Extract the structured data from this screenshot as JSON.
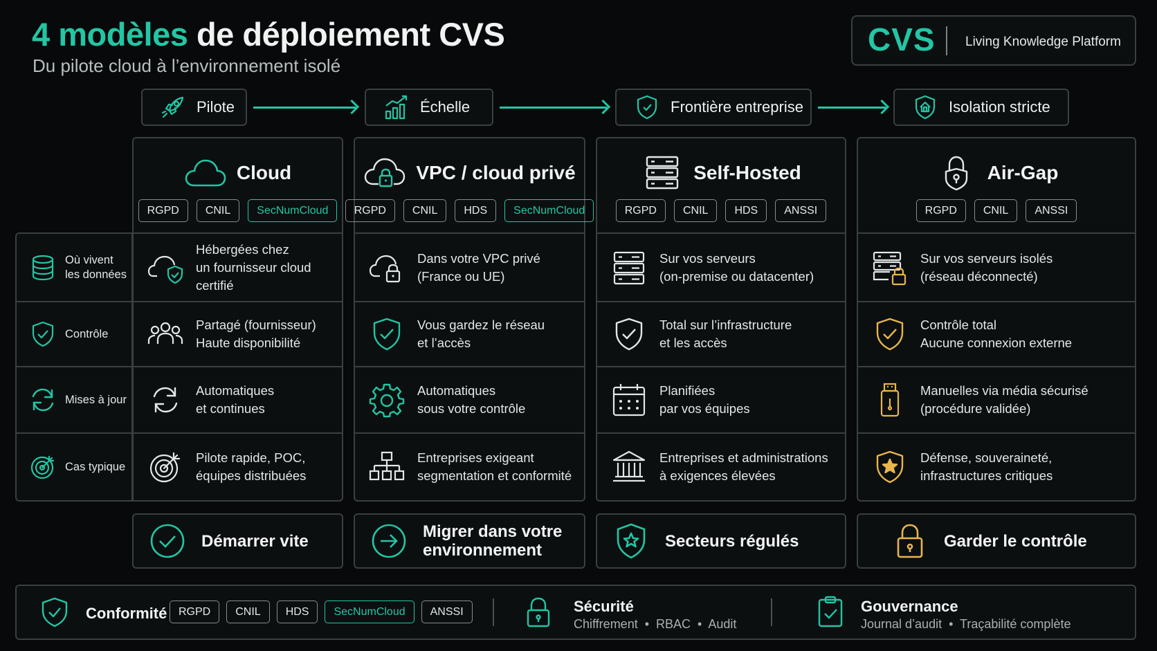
{
  "header": {
    "title_accent": "4 modèles",
    "title_rest": " de déploiement CVS",
    "subtitle": "Du pilote cloud à l’environnement isolé"
  },
  "logo": {
    "mark": "CVS",
    "tagline": "Living Knowledge Platform"
  },
  "stages": [
    {
      "label": "Pilote",
      "icon": "rocket-icon"
    },
    {
      "label": "Échelle",
      "icon": "growth-chart-icon"
    },
    {
      "label": "Frontière entreprise",
      "icon": "shield-icon"
    },
    {
      "label": "Isolation stricte",
      "icon": "shield-home-icon"
    }
  ],
  "columns": [
    {
      "title": "Cloud",
      "icon": "cloud-icon",
      "badges": [
        "RGPD",
        "CNIL",
        "SecNumCloud"
      ]
    },
    {
      "title": "VPC / cloud privé",
      "icon": "cloud-lock-icon",
      "badges": [
        "RGPD",
        "CNIL",
        "HDS",
        "SecNumCloud"
      ]
    },
    {
      "title": "Self-Hosted",
      "icon": "server-icon",
      "badges": [
        "RGPD",
        "CNIL",
        "HDS",
        "ANSSI"
      ]
    },
    {
      "title": "Air-Gap",
      "icon": "padlock-shield-icon",
      "badges": [
        "RGPD",
        "CNIL",
        "ANSSI"
      ]
    }
  ],
  "rows": [
    {
      "label_l1": "Où vivent",
      "label_l2": "les données",
      "icon": "database-icon"
    },
    {
      "label_l1": "Contrôle",
      "label_l2": "",
      "icon": "shield-check-icon"
    },
    {
      "label_l1": "Mises à jour",
      "label_l2": "",
      "icon": "refresh-icon"
    },
    {
      "label_l1": "Cas typique",
      "label_l2": "",
      "icon": "target-icon"
    }
  ],
  "cells": {
    "c0": [
      {
        "l1": "Hébergées chez",
        "l2": "un fournisseur cloud",
        "l3": "certifié"
      },
      {
        "l1": "Partagé (fournisseur)",
        "l2": "Haute disponibilité"
      },
      {
        "l1": "Automatiques",
        "l2": "et continues"
      },
      {
        "l1": "Pilote rapide, POC,",
        "l2": "équipes distribuées"
      }
    ],
    "c1": [
      {
        "l1": "Dans votre VPC privé",
        "l2": "(France ou UE)"
      },
      {
        "l1": "Vous gardez le réseau",
        "l2": "et l’accès"
      },
      {
        "l1": "Automatiques",
        "l2": "sous votre contrôle"
      },
      {
        "l1": "Entreprises exigeant",
        "l2": "segmentation et conformité"
      }
    ],
    "c2": [
      {
        "l1": "Sur vos serveurs",
        "l2": "(on-premise ou datacenter)"
      },
      {
        "l1": "Total sur l’infrastructure",
        "l2": "et les accès"
      },
      {
        "l1": "Planifiées",
        "l2": "par vos équipes"
      },
      {
        "l1": "Entreprises et administrations",
        "l2": "à exigences élevées"
      }
    ],
    "c3": [
      {
        "l1": "Sur vos serveurs isolés",
        "l2": "(réseau déconnecté)"
      },
      {
        "l1": "Contrôle total",
        "l2": "Aucune connexion externe"
      },
      {
        "l1": "Manuelles via média sécurisé",
        "l2": "(procédure validée)"
      },
      {
        "l1": "Défense, souveraineté,",
        "l2": "infrastructures critiques"
      }
    ]
  },
  "actions": [
    {
      "l1": "Démarrer vite",
      "l2": ""
    },
    {
      "l1": "Migrer dans votre",
      "l2": "environnement"
    },
    {
      "l1": "Secteurs régulés",
      "l2": ""
    },
    {
      "l1": "Garder le contrôle",
      "l2": ""
    }
  ],
  "footer": {
    "compliance_title": "Conformité",
    "compliance_badges": [
      "RGPD",
      "CNIL",
      "HDS",
      "SecNumCloud",
      "ANSSI"
    ],
    "security_title": "Sécurité",
    "security_sub": "Chiffrement  •  RBAC  •  Audit",
    "governance_title": "Gouvernance",
    "governance_sub": "Journal d’audit  •  Traçabilité complète"
  },
  "colors": {
    "accent": "#23c6a4",
    "gold": "#e8b64a",
    "border": "#3a3f42",
    "background": "#07090a"
  }
}
